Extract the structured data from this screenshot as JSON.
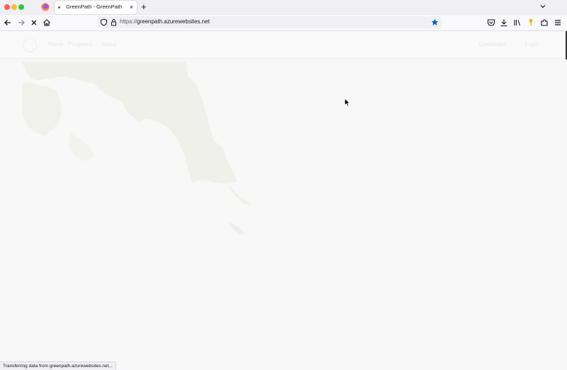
{
  "browser": {
    "tab": {
      "title": "GreenPath - GreenPath",
      "close_glyph": "×"
    },
    "new_tab_glyph": "+",
    "url": {
      "scheme": "https://",
      "host": "greenpath.azurewebsites.net"
    },
    "status_text": "Transferring data from greenpath.azurewebsites.net...",
    "colors": {
      "bookmark_star": "#0060df",
      "extension_key": "#f4b400"
    },
    "icons": {
      "back": "back-arrow-icon",
      "forward": "forward-arrow-icon",
      "stop": "stop-loading-icon",
      "home": "home-icon",
      "shield": "tracking-shield-icon",
      "lock": "lock-icon",
      "bookmark": "bookmark-star-icon",
      "pocket": "pocket-icon",
      "downloads": "download-icon",
      "library": "library-icon",
      "extension_key": "key-extension-icon",
      "extensions": "puzzle-extensions-icon",
      "menu": "hamburger-menu-icon"
    }
  },
  "site": {
    "nav": {
      "home": "Home",
      "programs": "Programs",
      "about": "About",
      "dashboard": "Dashboard",
      "login": "Login"
    }
  }
}
